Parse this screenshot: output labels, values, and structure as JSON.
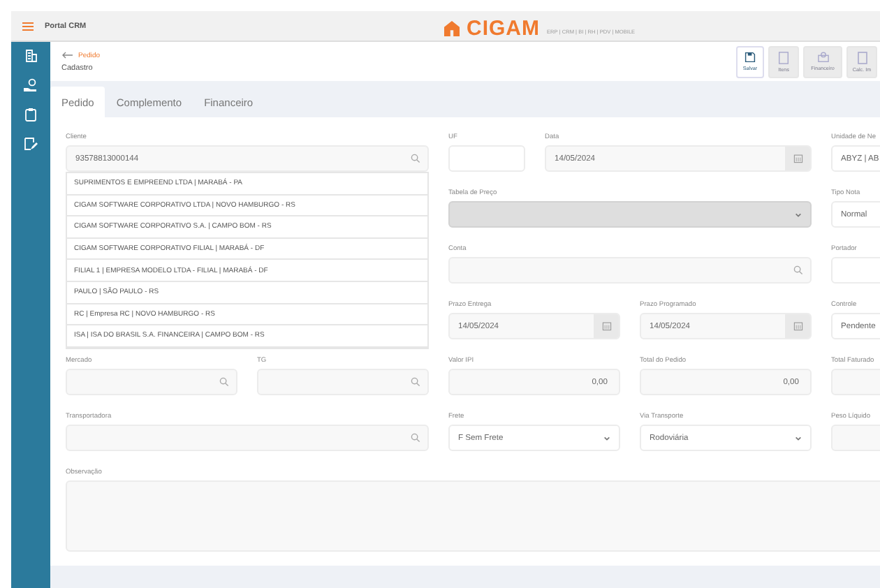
{
  "top_bar": {
    "app_name": "Portal CRM",
    "logo": "CIGAM",
    "logo_tagline": "ERP | CRM | BI | RH | PDV | MOBILE"
  },
  "header": {
    "breadcrumb": "Pedido",
    "title": "Cadastro"
  },
  "toolbar": [
    {
      "label": "Salvar",
      "disabled": false
    },
    {
      "label": "Itens",
      "disabled": true
    },
    {
      "label": "Financeiro",
      "disabled": true
    },
    {
      "label": "Calc. Im",
      "disabled": true
    }
  ],
  "tabs": [
    {
      "label": "Pedido",
      "selected": true
    },
    {
      "label": "Complemento",
      "selected": false
    },
    {
      "label": "Financeiro",
      "selected": false
    }
  ],
  "fields": [
    {
      "label": "Cliente",
      "kind": "search",
      "value": "93578813000144",
      "disabled": false,
      "suggestions": [
        "SUPRIMENTOS E EMPREEND LTDA | MARABÁ - PA",
        "CIGAM SOFTWARE CORPORATIVO LTDA | NOVO HAMBURGO - RS",
        "CIGAM SOFTWARE CORPORATIVO S.A. |  CAMPO BOM - RS",
        "CIGAM SOFTWARE CORPORATIVO  FILIAL | MARABÁ - DF",
        "FILIAL 1 | EMPRESA MODELO LTDA - FILIAL | MARABÁ - DF",
        "PAULO | SÃO PAULO - RS",
        "RC | Empresa RC | NOVO HAMBURGO - RS",
        "ISA | ISA DO BRASIL S.A. FINANCEIRA | CAMPO BOM - RS"
      ]
    },
    {
      "label": "UF",
      "kind": "text",
      "disabled": false
    },
    {
      "label": "Data",
      "kind": "date",
      "value": "14/05/2024",
      "disabled": false
    },
    {
      "label": "Unidade de Ne",
      "kind": "text",
      "value": "ABYZ | AB",
      "disabled": false
    },
    {
      "label": "Tabela de Preço",
      "kind": "select",
      "disabled": true
    },
    {
      "label": "Tipo Nota",
      "kind": "text",
      "value": "Normal",
      "disabled": false
    },
    {
      "label": "Conta",
      "kind": "search",
      "disabled": false
    },
    {
      "label": "Portador",
      "kind": "text",
      "disabled": false
    },
    {
      "label": "Prazo Entrega",
      "kind": "date",
      "value": "14/05/2024",
      "disabled": false
    },
    {
      "label": "Prazo Programado",
      "kind": "date",
      "value": "14/05/2024",
      "disabled": false
    },
    {
      "label": "Controle",
      "kind": "text",
      "value": "Pendente",
      "disabled": false
    },
    {
      "label": "Mercado",
      "kind": "search",
      "disabled": false
    },
    {
      "label": "TG",
      "kind": "search",
      "disabled": false
    },
    {
      "label": "Valor IPI",
      "kind": "number",
      "value": "0,00",
      "disabled": false
    },
    {
      "label": "Total do Pedido",
      "kind": "number",
      "value": "0,00",
      "disabled": false
    },
    {
      "label": "Total Faturado",
      "kind": "number",
      "disabled": false
    },
    {
      "label": "Transportadora",
      "kind": "search",
      "disabled": false
    },
    {
      "label": "Frete",
      "kind": "select",
      "value": "F Sem Frete",
      "disabled": false
    },
    {
      "label": "Via Transporte",
      "kind": "select",
      "value": "Rodoviária",
      "disabled": false
    },
    {
      "label": "Peso Líquido",
      "kind": "number",
      "disabled": false
    },
    {
      "label": "Observação",
      "kind": "textarea",
      "disabled": false
    }
  ]
}
